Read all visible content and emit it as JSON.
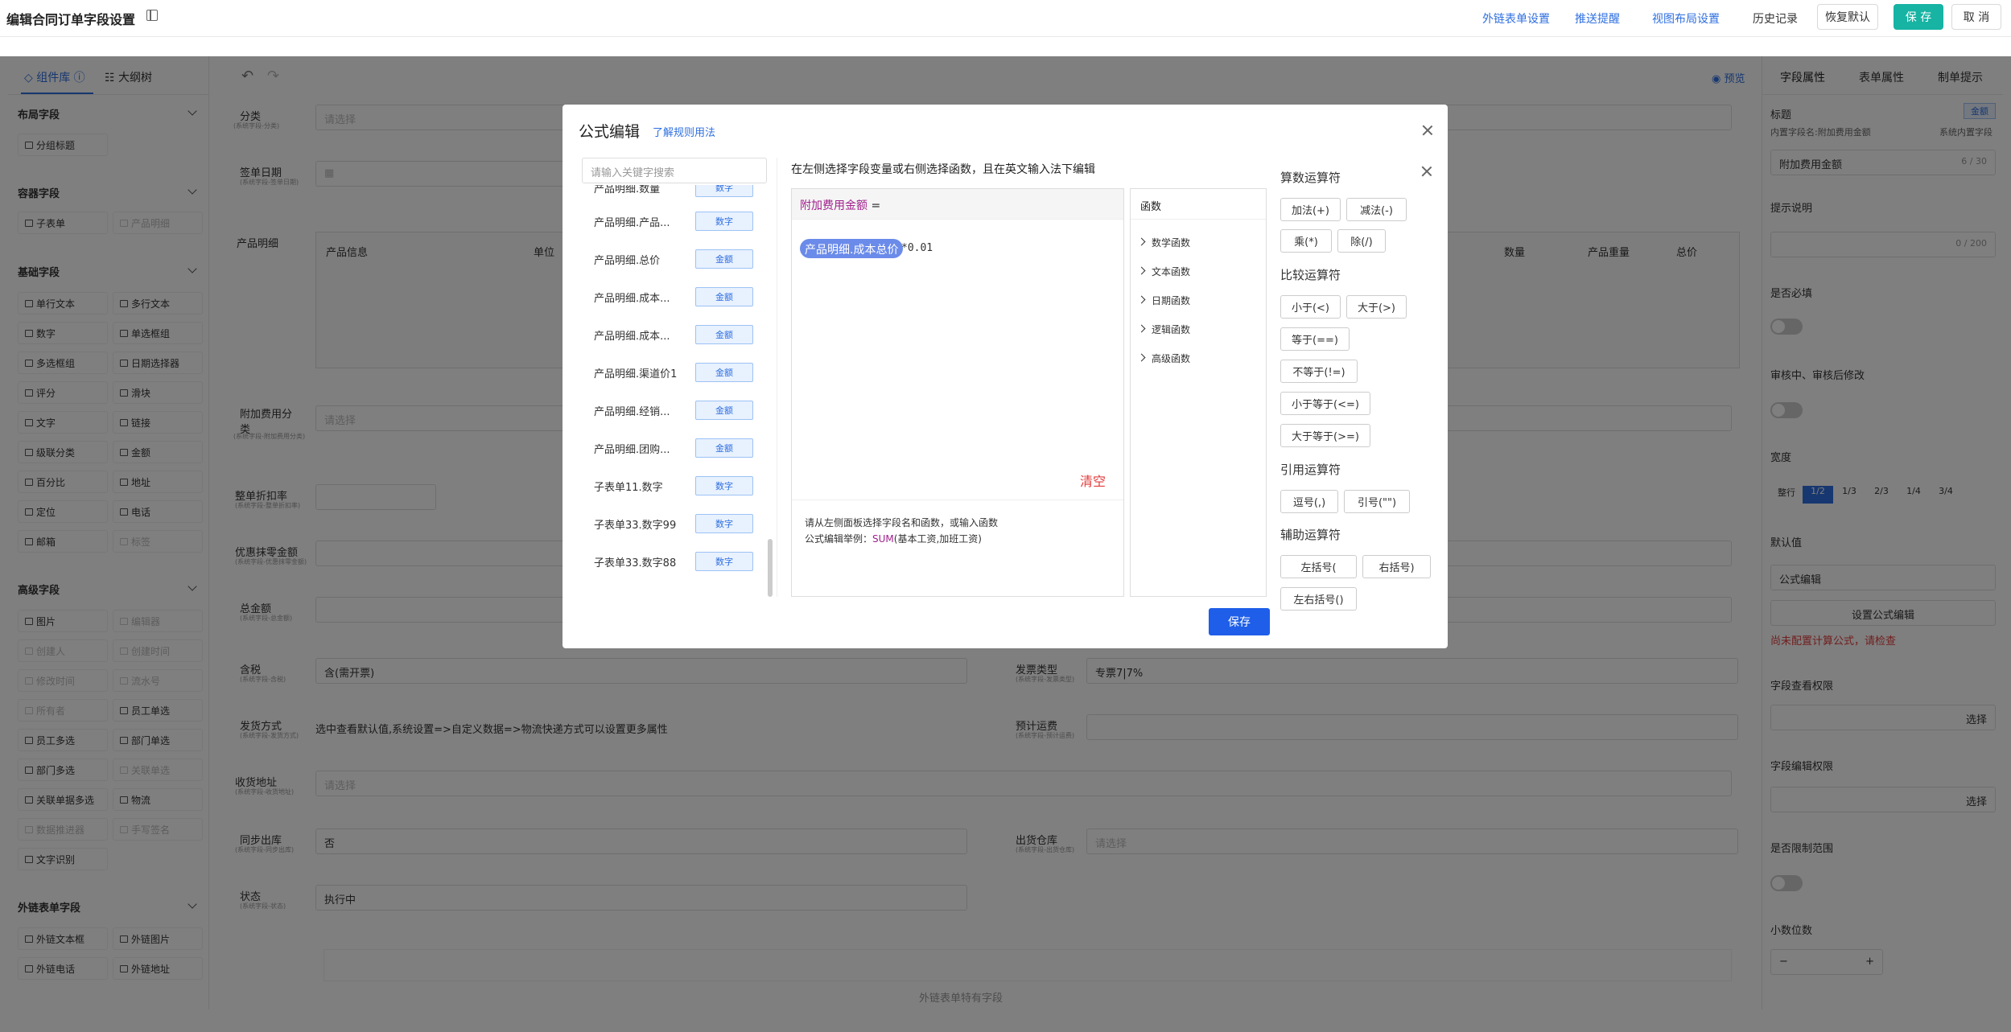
{
  "header": {
    "title": "编辑合同订单字段设置",
    "links": [
      "外链表单设置",
      "推送提醒",
      "视图布局设置"
    ],
    "history": "历史记录",
    "restore": "恢复默认",
    "save": "保 存",
    "cancel": "取 消"
  },
  "left_panel": {
    "tabs": [
      "组件库",
      "大纲树"
    ],
    "sections": {
      "layout": "布局字段",
      "container": "容器字段",
      "basic": "基础字段",
      "advanced": "高级字段",
      "external": "外链表单字段"
    },
    "layout_items": [
      "分组标题"
    ],
    "container_items": [
      "子表单",
      "产品明细"
    ],
    "basic_items": [
      "单行文本",
      "多行文本",
      "数字",
      "单选框组",
      "多选框组",
      "日期选择器",
      "评分",
      "滑块",
      "文字",
      "链接",
      "级联分类",
      "金额",
      "百分比",
      "地址",
      "定位",
      "电话",
      "邮箱",
      "标签"
    ],
    "advanced_items": [
      "图片",
      "编辑器",
      "创建人",
      "创建时间",
      "修改时间",
      "流水号",
      "所有者",
      "员工单选",
      "员工多选",
      "部门单选",
      "部门多选",
      "关联单选",
      "关联单据多选",
      "物流",
      "数据推进器",
      "手写签名",
      "文字识别"
    ],
    "external_items": [
      "外链文本框",
      "外链图片",
      "外链电话",
      "外链地址"
    ]
  },
  "canvas": {
    "toolbar_preview": "预览",
    "fields": [
      {
        "label": "分类",
        "sub": "(系统字段-分类)",
        "placeholder": "请选择"
      },
      {
        "label": "签单日期",
        "sub": "(系统字段-签单日期)"
      },
      {
        "label": "产品明细"
      },
      {
        "label": "附加费用分类",
        "sub": "(系统字段-附加费用分类)",
        "placeholder": "请选择"
      },
      {
        "label": "整单折扣率",
        "sub": "(系统字段-整单折扣率)"
      },
      {
        "label": "优惠抹零金额",
        "sub": "(系统字段-优惠抹零金额)"
      },
      {
        "label": "总金额",
        "sub": "(系统字段-总金额)"
      },
      {
        "label": "含税",
        "sub": "(系统字段-含税)",
        "value": "含(需开票)"
      },
      {
        "label": "发货方式",
        "sub": "(系统字段-发货方式)",
        "value": "选中查看默认值,系统设置=>自定义数据=>物流快递方式可以设置更多属性"
      },
      {
        "label": "收货地址",
        "sub": "(系统字段-收货地址)",
        "placeholder": "请选择"
      },
      {
        "label": "同步出库",
        "sub": "(系统字段-同步出库)",
        "value": "否"
      },
      {
        "label": "状态",
        "sub": "(系统字段-状态)",
        "value": "执行中"
      }
    ],
    "right_fields": [
      {
        "label": "发票类型",
        "sub": "(系统字段-发票类型)",
        "value": "专票7|7%"
      },
      {
        "label": "预计运费",
        "sub": "(系统字段-预计运费)"
      },
      {
        "label": "出货仓库",
        "sub": "(系统字段-出货仓库)",
        "placeholder": "请选择"
      }
    ],
    "table_headers": [
      "产品信息",
      "单位",
      "数量",
      "产品重量",
      "总价"
    ],
    "footer_label": "外链表单特有字段"
  },
  "right_panel": {
    "tabs": [
      "字段属性",
      "表单属性",
      "制单提示"
    ],
    "title_label": "标题",
    "title_tag": "金额",
    "inner_name": "内置字段名:附加费用金额",
    "inner_tag": "系统内置字段",
    "title_value": "附加费用金额",
    "title_count": "6 / 30",
    "hint_label": "提示说明",
    "hint_count": "0 / 200",
    "required_label": "是否必填",
    "audit_label": "审核中、审核后修改",
    "width_label": "宽度",
    "width_options": [
      "整行",
      "1/2",
      "1/3",
      "2/3",
      "1/4",
      "3/4"
    ],
    "width_selected": "1/2",
    "default_label": "默认值",
    "default_value": "公式编辑",
    "formula_button": "设置公式编辑",
    "formula_error": "尚未配置计算公式，请检查",
    "view_perm_label": "字段查看权限",
    "edit_perm_label": "字段编辑权限",
    "select_label": "选择",
    "range_label": "是否限制范围",
    "decimal_label": "小数位数",
    "decimal_minus": "−",
    "decimal_plus": "+"
  },
  "modal": {
    "title": "公式编辑",
    "help_link": "了解规则用法",
    "search_placeholder": "请输入关键字搜索",
    "fields": [
      {
        "name": "产品明细.数量",
        "type": "数字"
      },
      {
        "name": "产品明细.产品...",
        "type": "数字"
      },
      {
        "name": "产品明细.总价",
        "type": "金额"
      },
      {
        "name": "产品明细.成本...",
        "type": "金额"
      },
      {
        "name": "产品明细.成本...",
        "type": "金额"
      },
      {
        "name": "产品明细.渠道价1",
        "type": "金额"
      },
      {
        "name": "产品明细.经销...",
        "type": "金额"
      },
      {
        "name": "产品明细.团购...",
        "type": "金额"
      },
      {
        "name": "子表单11.数字",
        "type": "数字"
      },
      {
        "name": "子表单33.数字99",
        "type": "数字"
      },
      {
        "name": "子表单33.数字88",
        "type": "数字"
      }
    ],
    "instruction": "在左侧选择字段变量或右侧选择函数，且在英文输入法下编辑",
    "target_field": "附加费用金额",
    "equals": " =",
    "formula_chip": "产品明细.成本总价",
    "formula_rest": "*0.01",
    "clear": "清空",
    "hint_line1": "请从左侧面板选择字段名和函数，或输入函数",
    "hint_line2_prefix": "公式编辑举例：",
    "hint_fn": "SUM",
    "hint_line2_suffix": "(基本工资,加班工资)",
    "functions_header": "函数",
    "functions": [
      "数学函数",
      "文本函数",
      "日期函数",
      "逻辑函数",
      "高级函数"
    ],
    "op_groups": {
      "arith_title": "算数运算符",
      "arith": [
        "加法(+)",
        "减法(-)",
        "乘(*)",
        "除(/)"
      ],
      "compare_title": "比较运算符",
      "compare": [
        "小于(<)",
        "大于(>)",
        "等于(==)",
        "不等于(!=)",
        "小于等于(<=)",
        "大于等于(>=)"
      ],
      "quote_title": "引用运算符",
      "quote": [
        "逗号(,)",
        "引号(\"\")"
      ],
      "aux_title": "辅助运算符",
      "aux": [
        "左括号(",
        "右括号)",
        "左右括号()"
      ]
    },
    "save": "保存"
  }
}
